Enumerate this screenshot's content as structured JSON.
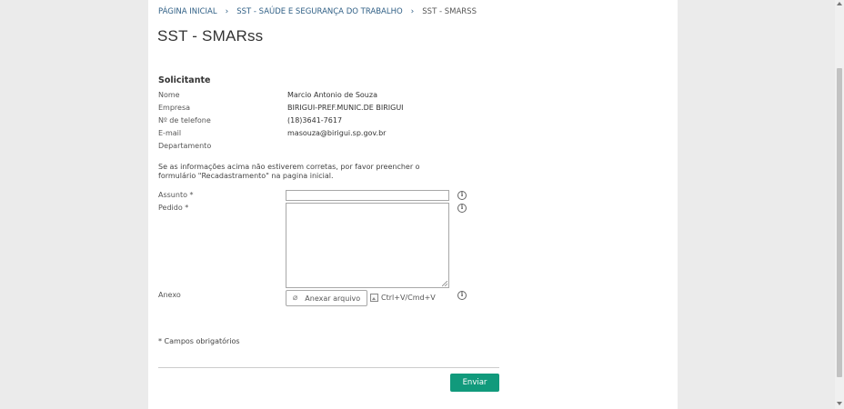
{
  "breadcrumb": {
    "items": [
      "PÁGINA INICIAL",
      "SST - SAÚDE E SEGURANÇA DO TRABALHO",
      "SST - SMARSS"
    ]
  },
  "page_title": "SST - SMARss",
  "requester": {
    "section_title": "Solicitante",
    "fields": [
      {
        "label": "Nome",
        "value": "Marcio Antonio de Souza"
      },
      {
        "label": "Empresa",
        "value": "BIRIGUI-PREF.MUNIC.DE BIRIGUI"
      },
      {
        "label": "Nº de telefone",
        "value": "(18)3641-7617"
      },
      {
        "label": "E-mail",
        "value": "masouza@birigui.sp.gov.br"
      },
      {
        "label": "Departamento",
        "value": ""
      }
    ]
  },
  "note": "Se as informações acima não estiverem corretas, por favor preencher o formulário \"Recadastramento\" na pagina inicial.",
  "form": {
    "subject_label": "Assunto *",
    "subject_value": "",
    "request_label": "Pedido *",
    "request_value": "",
    "attachment_label": "Anexo",
    "attach_button": "Anexar arquivo",
    "paste_hint": "Ctrl+V/Cmd+V",
    "required_note": "* Campos obrigatórios",
    "submit_label": "Enviar"
  },
  "icons": {
    "info": "info-icon",
    "attach": "paperclip-icon",
    "paste": "image-icon"
  },
  "colors": {
    "primary_button": "#119a7c",
    "link": "#2f5f85"
  }
}
